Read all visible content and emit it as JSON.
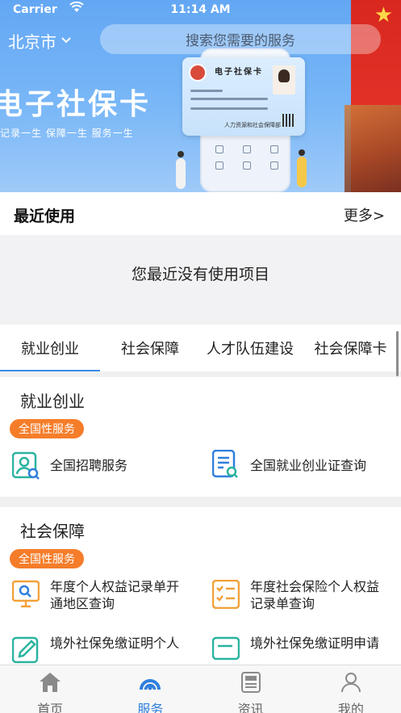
{
  "status_bar": {
    "carrier": "Carrier",
    "time": "11:14 AM"
  },
  "header": {
    "city": "北京市",
    "search_placeholder": "搜索您需要的服务"
  },
  "banner": {
    "title": "电子社保卡",
    "slogan": "记录一生   保障一生   服务一生",
    "card_title": "电子社保卡",
    "card_issuer": "人力资源和社会保障部"
  },
  "recent": {
    "title": "最近使用",
    "more": "更多>",
    "empty_text": "您最近没有使用项目"
  },
  "tabs": [
    "就业创业",
    "社会保障",
    "人才队伍建设",
    "社会保障卡"
  ],
  "sections": [
    {
      "title": "就业创业",
      "badge": "全国性服务",
      "items": [
        {
          "label": "全国招聘服务",
          "icon": "job-search-icon"
        },
        {
          "label": "全国就业创业证查询",
          "icon": "document-search-icon"
        }
      ]
    },
    {
      "title": "社会保障",
      "badge": "全国性服务",
      "items": [
        {
          "label": "年度个人权益记录单开通地区查询",
          "icon": "monitor-search-icon"
        },
        {
          "label": "年度社会保险个人权益记录单查询",
          "icon": "checklist-icon"
        },
        {
          "label": "境外社保免缴证明个人",
          "icon": "edit-document-icon"
        },
        {
          "label": "境外社保免缴证明申请",
          "icon": "id-card-icon"
        }
      ]
    }
  ],
  "tabbar": [
    {
      "label": "首页",
      "icon": "home-icon",
      "active": false
    },
    {
      "label": "服务",
      "icon": "service-icon",
      "active": true
    },
    {
      "label": "资讯",
      "icon": "news-icon",
      "active": false
    },
    {
      "label": "我的",
      "icon": "user-icon",
      "active": false
    }
  ],
  "colors": {
    "accent": "#2f7fdc",
    "badge": "#f57d2a",
    "teal_icon": "#2ab3a0",
    "blue_icon": "#2f7fdc",
    "orange_icon": "#f2a13a"
  }
}
